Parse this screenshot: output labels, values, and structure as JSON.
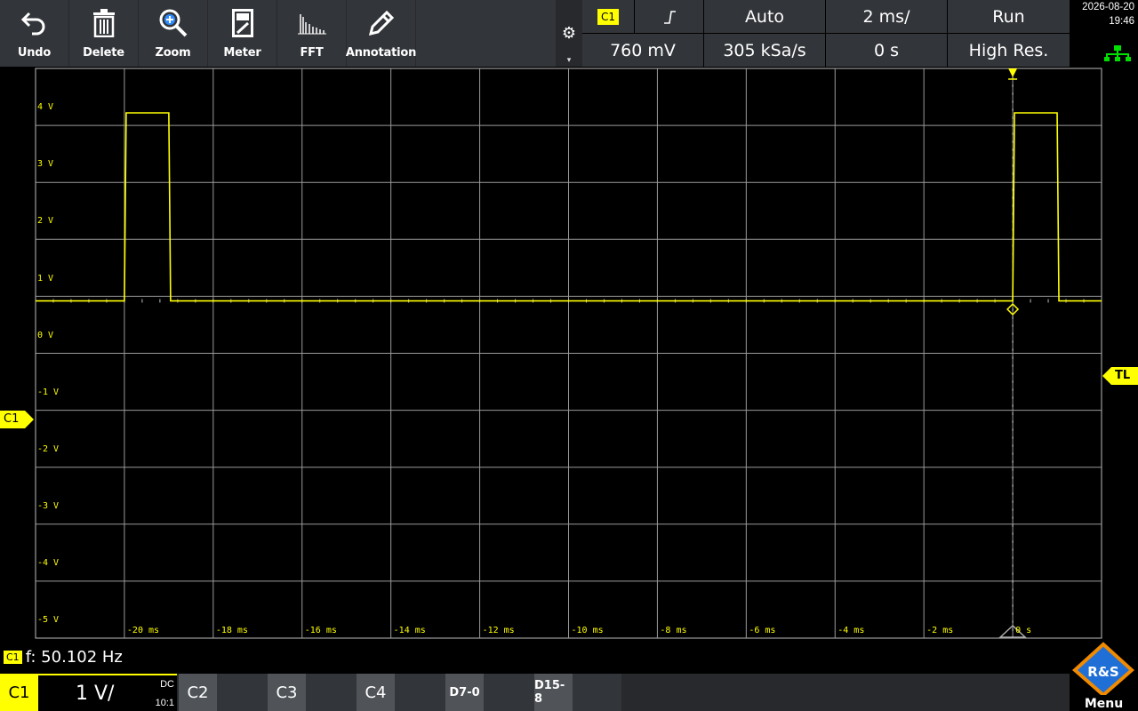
{
  "toolbar": {
    "items": [
      {
        "label": "Undo",
        "icon": "undo-icon"
      },
      {
        "label": "Delete",
        "icon": "trash-icon"
      },
      {
        "label": "Zoom",
        "icon": "zoom-icon"
      },
      {
        "label": "Meter",
        "icon": "meter-icon"
      },
      {
        "label": "FFT",
        "icon": "fft-icon"
      },
      {
        "label": "Annotation",
        "icon": "pencil-icon"
      }
    ]
  },
  "settings": {
    "trigger_source": "C1",
    "trigger_slope_icon": "rising-edge-icon",
    "trigger_mode": "Auto",
    "timebase": "2 ms/",
    "run_state": "Run",
    "trigger_level": "760 mV",
    "sample_rate": "305 kSa/s",
    "horizontal_position": "0 s",
    "acquisition_mode": "High Res."
  },
  "clock": {
    "date": "2026-08-20",
    "time": "19:46"
  },
  "plot": {
    "y_labels": [
      "4 V",
      "3 V",
      "2 V",
      "1 V",
      "0 V",
      "-1 V",
      "-2 V",
      "-3 V",
      "-4 V",
      "-5 V"
    ],
    "x_labels": [
      "-20 ms",
      "-18 ms",
      "-16 ms",
      "-14 ms",
      "-12 ms",
      "-10 ms",
      "-8 ms",
      "-6 ms",
      "-4 ms",
      "-2 ms",
      "0 s"
    ],
    "channel_marker": "C1",
    "trigger_level_marker": "TL",
    "trace_color": "#ffff00",
    "pulses_ms": [
      [
        -20.0,
        -19.0
      ],
      [
        0.0,
        1.0
      ]
    ],
    "pulse_high_v": 3.3,
    "low_v": 0.0
  },
  "measurement": {
    "channel": "C1",
    "text": "f: 50.102 Hz"
  },
  "channels": {
    "c1": {
      "name": "C1",
      "scale": "1 V/",
      "coupling": "DC",
      "probe": "10:1"
    },
    "others": [
      "C2",
      "C3",
      "C4",
      "D7-0",
      "D15-8"
    ]
  },
  "menu": {
    "label": "Menu",
    "logo_text": "R&S"
  }
}
